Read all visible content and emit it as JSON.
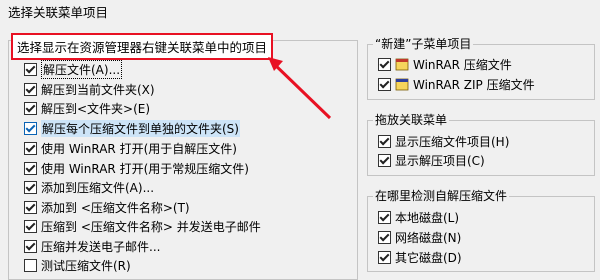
{
  "window": {
    "title": "选择关联菜单项目"
  },
  "context_menu_items": {
    "heading": "选择显示在资源管理器右键关联菜单中的项目",
    "items": [
      {
        "label": "解压文件(A)...",
        "checked": true
      },
      {
        "label": "解压到当前文件夹(X)",
        "checked": true
      },
      {
        "label": "解压到<文件夹>(E)",
        "checked": true
      },
      {
        "label": "解压每个压缩文件到单独的文件夹(S)",
        "checked": true
      },
      {
        "label": "使用 WinRAR 打开(用于自解压文件)",
        "checked": true
      },
      {
        "label": "使用 WinRAR 打开(用于常规压缩文件)",
        "checked": true
      },
      {
        "label": "添加到压缩文件(A)...",
        "checked": true
      },
      {
        "label": "添加到 <压缩文件名称>(T)",
        "checked": true
      },
      {
        "label": "压缩到 <压缩文件名称> 并发送电子邮件",
        "checked": true
      },
      {
        "label": "压缩并发送电子邮件...",
        "checked": true
      },
      {
        "label": "测试压缩文件(R)",
        "checked": false
      }
    ]
  },
  "new_submenu": {
    "title": "“新建”子菜单项目",
    "items": [
      {
        "label": "WinRAR 压缩文件",
        "checked": true
      },
      {
        "label": "WinRAR ZIP 压缩文件",
        "checked": true
      }
    ]
  },
  "drag_drop": {
    "title": "拖放关联菜单",
    "items": [
      {
        "label": "显示压缩文件项目(H)",
        "checked": true
      },
      {
        "label": "显示解压项目(C)",
        "checked": true
      }
    ]
  },
  "sfx_detect": {
    "title": "在哪里检测自解压缩文件",
    "items": [
      {
        "label": "本地磁盘(L)",
        "checked": true
      },
      {
        "label": "网络磁盘(N)",
        "checked": true
      },
      {
        "label": "其它磁盘(D)",
        "checked": true
      }
    ]
  }
}
